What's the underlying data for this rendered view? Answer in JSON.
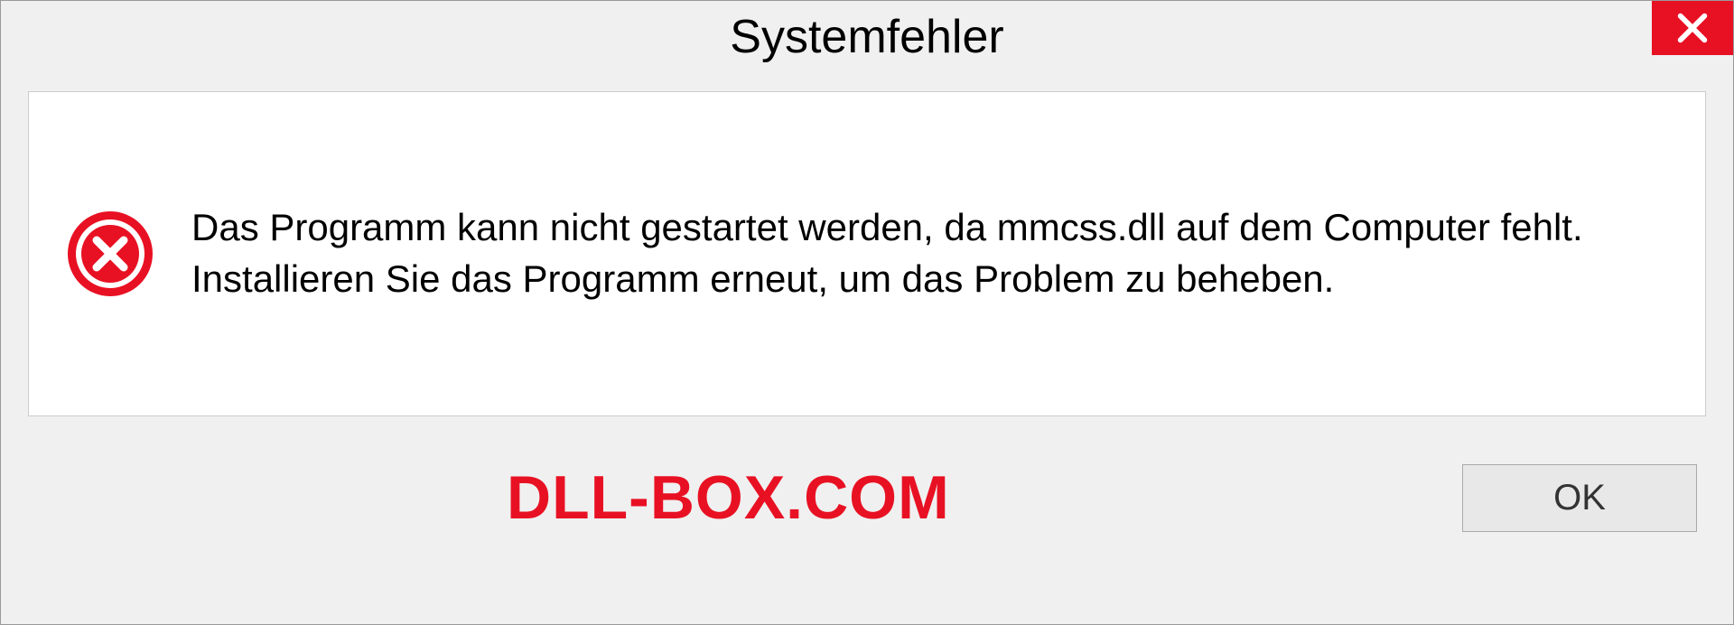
{
  "dialog": {
    "title": "Systemfehler",
    "message": "Das Programm kann nicht gestartet werden, da mmcss.dll auf dem Computer fehlt. Installieren Sie das Programm erneut, um das Problem zu beheben.",
    "ok_label": "OK"
  },
  "watermark": "DLL-BOX.COM",
  "colors": {
    "error_red": "#e81123",
    "background": "#f0f0f0",
    "content_bg": "#ffffff"
  }
}
